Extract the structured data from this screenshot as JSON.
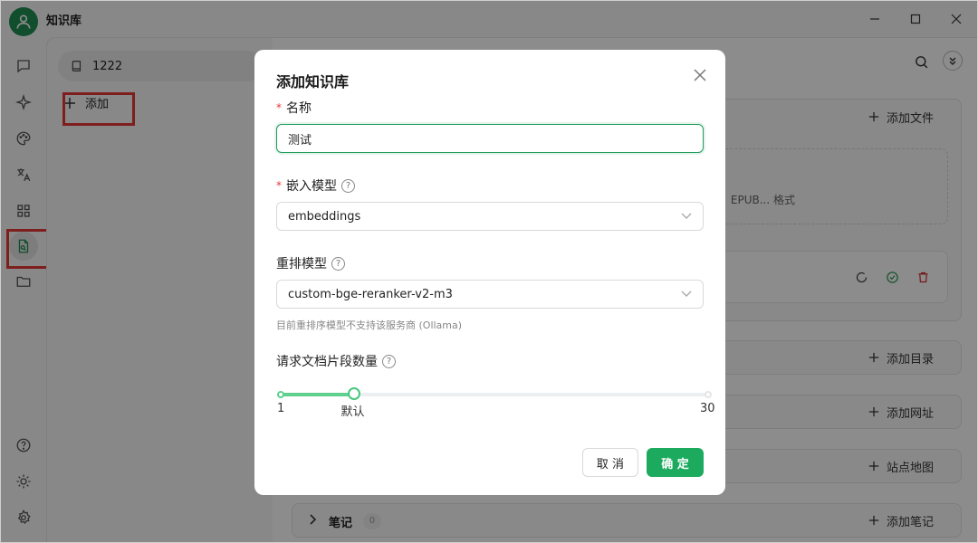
{
  "app": {
    "title": "知识库"
  },
  "knowledge_base_list": {
    "items": [
      {
        "label": "1222"
      }
    ],
    "add_label": "添加"
  },
  "main": {
    "drop_zone_text": "EPUB... 格式",
    "sections": [
      {
        "action_label": "添加文件"
      },
      {
        "action_label": "添加目录"
      },
      {
        "action_label": "添加网址"
      },
      {
        "action_label": "站点地图"
      },
      {
        "label": "笔记",
        "count": "0",
        "action_label": "添加笔记"
      }
    ]
  },
  "dialog": {
    "title": "添加知识库",
    "name_field": {
      "label": "名称",
      "required_mark": "*",
      "value": "测试"
    },
    "embedding_model": {
      "label": "嵌入模型",
      "required_mark": "*",
      "value": "embeddings"
    },
    "rerank_model": {
      "label": "重排模型",
      "value": "custom-bge-reranker-v2-m3",
      "hint": "目前重排序模型不支持该服务商 (Ollama)"
    },
    "doc_count": {
      "label": "请求文档片段数量",
      "min_label": "1",
      "default_label": "默认",
      "max_label": "30",
      "min": 1,
      "max": 30,
      "value": 6
    },
    "cancel_label": "取 消",
    "confirm_label": "确 定"
  },
  "colors": {
    "accent": "#1cab5e",
    "highlight_box": "#e53935",
    "overlay": "rgba(0,0,0,0.45)"
  }
}
